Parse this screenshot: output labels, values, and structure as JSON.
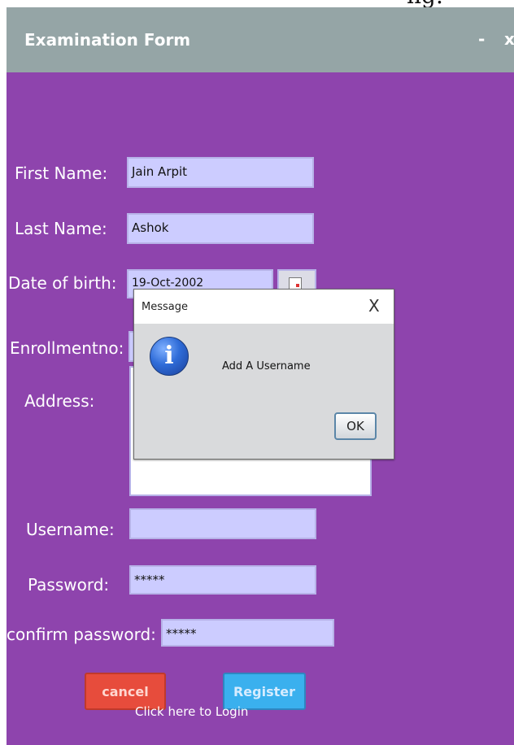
{
  "window": {
    "title": "Examination Form",
    "minimize_label": "-",
    "close_label": "x",
    "partial_text_above": "ng."
  },
  "form": {
    "first_name": {
      "label": "First Name:",
      "value": "Jain Arpit"
    },
    "last_name": {
      "label": "Last Name:",
      "value": "Ashok"
    },
    "dob": {
      "label": "Date of birth:",
      "value": "19-Oct-2002"
    },
    "enrollment": {
      "label": "Enrollmentno:",
      "value": ""
    },
    "address": {
      "label": "Address:",
      "value": ""
    },
    "username": {
      "label": "Username:",
      "value": ""
    },
    "password": {
      "label": "Password:",
      "value": "*****"
    },
    "confirm_password": {
      "label": "confirm password:",
      "value": "*****"
    }
  },
  "buttons": {
    "cancel": "cancel",
    "register": "Register",
    "login_link": "Click here to Login"
  },
  "dialog": {
    "title": "Message",
    "close_label": "X",
    "icon": "info-icon",
    "icon_glyph": "i",
    "message": "Add A Username",
    "ok_label": "OK"
  },
  "colors": {
    "form_background": "#8e44ad",
    "titlebar": "#95a5a6",
    "field_background": "#ccccff",
    "cancel_button": "#e74c3c",
    "register_button": "#3ab0ee",
    "dialog_background": "#d9dadc"
  }
}
